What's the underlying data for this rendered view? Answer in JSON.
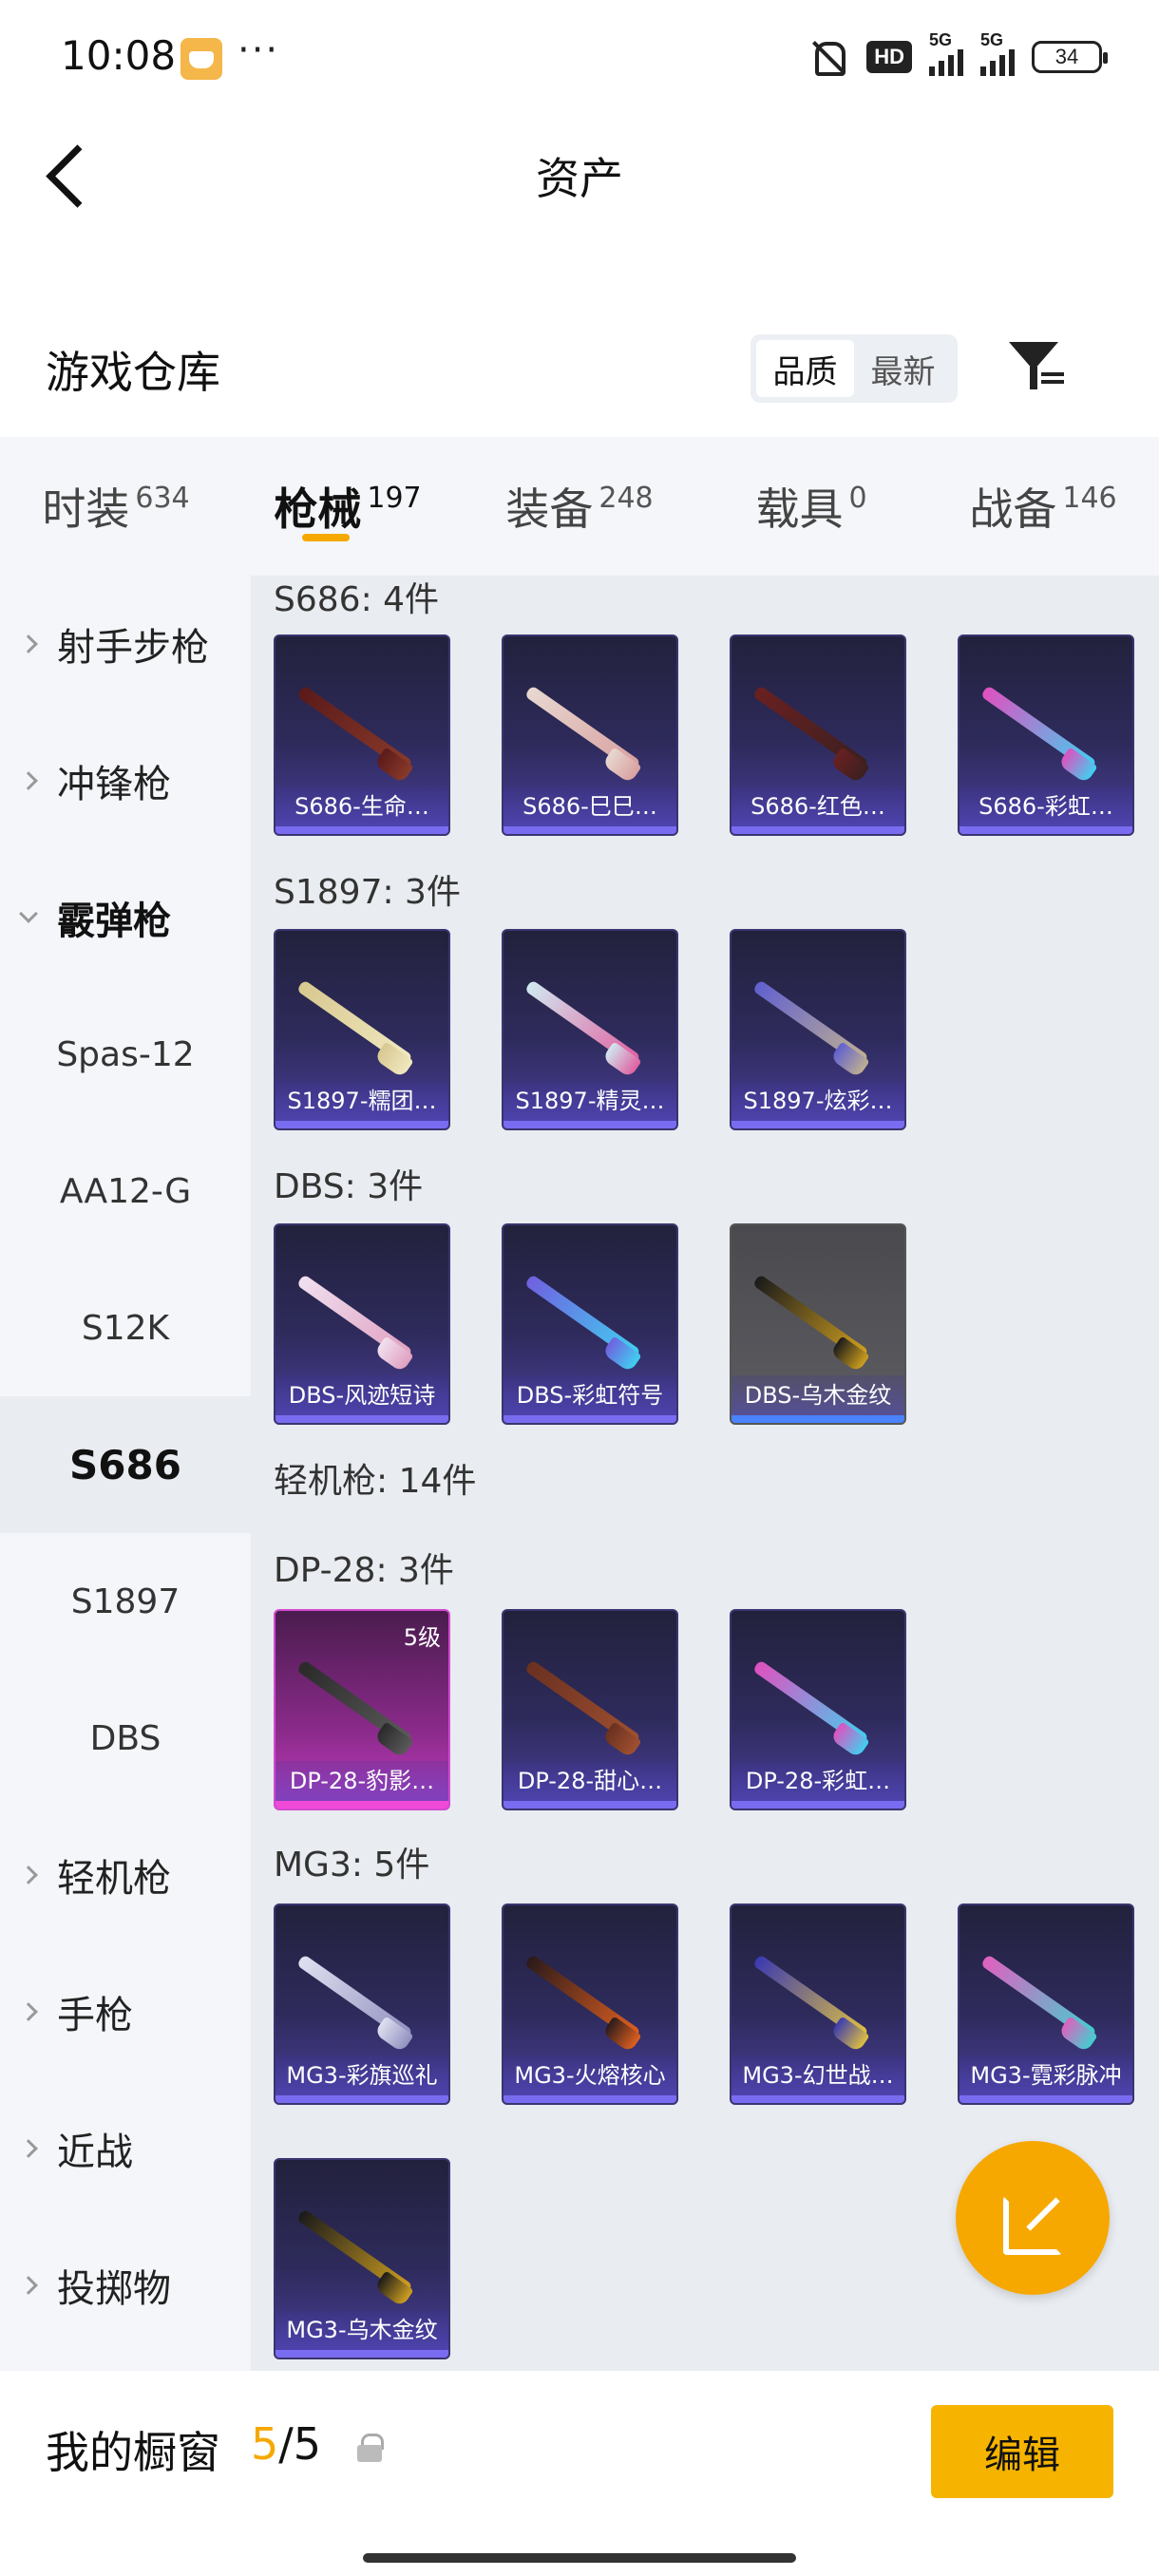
{
  "status_bar": {
    "time": "10:08",
    "dots": "···",
    "hd": "HD",
    "net1": "5G",
    "net2": "5G",
    "battery": "34"
  },
  "header": {
    "title": "资产",
    "back_icon": "back-arrow-icon"
  },
  "warehouse": {
    "title": "游戏仓库",
    "sort_options": [
      "品质",
      "最新"
    ],
    "active_sort": "品质"
  },
  "categories": [
    {
      "label": "时装",
      "count": "634"
    },
    {
      "label": "枪械",
      "count": "197"
    },
    {
      "label": "装备",
      "count": "248"
    },
    {
      "label": "载具",
      "count": "0"
    },
    {
      "label": "战备",
      "count": "146"
    }
  ],
  "active_category": "枪械",
  "sidebar": {
    "items": [
      {
        "label": "射手步枪"
      },
      {
        "label": "冲锋枪"
      },
      {
        "label": "霰弹枪"
      },
      {
        "label": "Spas-12"
      },
      {
        "label": "AA12-G"
      },
      {
        "label": "S12K"
      },
      {
        "label": "S686"
      },
      {
        "label": "S1897"
      },
      {
        "label": "DBS"
      },
      {
        "label": "轻机枪"
      },
      {
        "label": "手枪"
      },
      {
        "label": "近战"
      },
      {
        "label": "投掷物"
      }
    ]
  },
  "groups": [
    {
      "label": "S686: 4件",
      "items": [
        {
          "name": "S686-生命…",
          "colors": [
            "#5a1a1a",
            "#8a3a2a"
          ]
        },
        {
          "name": "S686-巳巳…",
          "colors": [
            "#e8d8d0",
            "#d8a0a0"
          ]
        },
        {
          "name": "S686-红色…",
          "colors": [
            "#6a2020",
            "#3a2020"
          ]
        },
        {
          "name": "S686-彩虹…",
          "colors": [
            "#e050c0",
            "#40d0f0"
          ]
        }
      ]
    },
    {
      "label": "S1897: 3件",
      "items": [
        {
          "name": "S1897-糯团…",
          "colors": [
            "#d8c890",
            "#f0e8c0"
          ]
        },
        {
          "name": "S1897-精灵…",
          "colors": [
            "#d0e8f0",
            "#e060a0"
          ]
        },
        {
          "name": "S1897-炫彩…",
          "colors": [
            "#6060d0",
            "#c0b090"
          ]
        }
      ]
    },
    {
      "label": "DBS: 3件",
      "items": [
        {
          "name": "DBS-风迹短诗",
          "colors": [
            "#f0e0f0",
            "#e0a0c0"
          ]
        },
        {
          "name": "DBS-彩虹符号",
          "colors": [
            "#7060e0",
            "#40d0f0"
          ]
        },
        {
          "name": "DBS-乌木金纹",
          "colors": [
            "#1a1a1a",
            "#d0a020"
          ]
        }
      ]
    },
    {
      "label": "轻机枪: 14件",
      "items": []
    },
    {
      "label": "DP-28: 3件",
      "items": [
        {
          "name": "DP-28-豹影…",
          "colors": [
            "#2a2a2a",
            "#5a5a5a"
          ],
          "level": "5级"
        },
        {
          "name": "DP-28-甜心…",
          "colors": [
            "#6a3020",
            "#a05030"
          ]
        },
        {
          "name": "DP-28-彩虹…",
          "colors": [
            "#e050c0",
            "#40d0f0"
          ]
        }
      ]
    },
    {
      "label": "MG3: 5件",
      "items": [
        {
          "name": "MG3-彩旗巡礼",
          "colors": [
            "#e0e0f0",
            "#9090c0"
          ]
        },
        {
          "name": "MG3-火熔核心",
          "colors": [
            "#2a1a1a",
            "#e06020"
          ]
        },
        {
          "name": "MG3-幻世战…",
          "colors": [
            "#3a3ab0",
            "#e0c040"
          ]
        },
        {
          "name": "MG3-霓彩脉冲",
          "colors": [
            "#e060c0",
            "#40d0d0"
          ]
        },
        {
          "name": "MG3-乌木金纹",
          "colors": [
            "#1a1a1a",
            "#d0a020"
          ]
        }
      ]
    }
  ],
  "bottom_bar": {
    "label": "我的橱窗",
    "current": "5",
    "separator": "/",
    "total": "5",
    "edit_label": "编辑"
  }
}
